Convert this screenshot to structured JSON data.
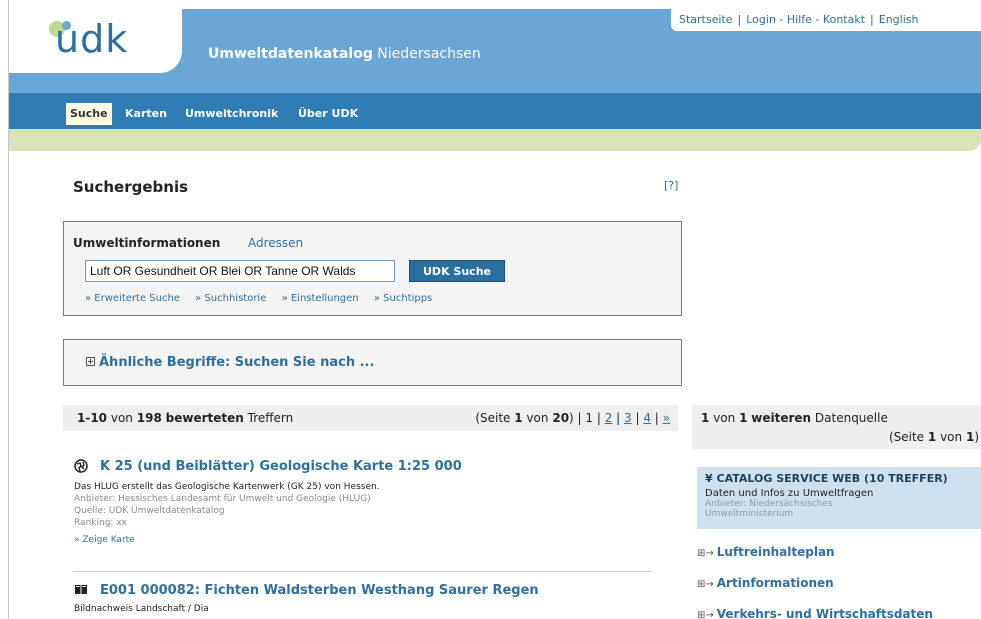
{
  "header": {
    "logo_text": "udk",
    "site_title_bold": "Umweltdatenkatalog",
    "site_title_rest": "Niedersachsen",
    "toplinks": {
      "start": "Startseite",
      "sep": "|",
      "login": "Login",
      "dash": "-",
      "help": "Hilfe",
      "contact": "Kontakt",
      "english": "English"
    }
  },
  "nav": {
    "items": [
      "Suche",
      "Karten",
      "Umweltchronik",
      "Über UDK"
    ],
    "active": "Suche"
  },
  "page": {
    "title": "Suchergebnis",
    "help": "[?]"
  },
  "search": {
    "tab_active": "Umweltinformationen",
    "tab_other": "Adressen",
    "query": "Luft OR Gesundheit OR Blei OR Tanne OR Walds",
    "button": "UDK Suche",
    "links": [
      "Erweiterte Suche",
      "Suchhistorie",
      "Einstellungen",
      "Suchtipps"
    ]
  },
  "similar": {
    "label": "Ähnliche Begriffe: Suchen Sie nach ..."
  },
  "results": {
    "range": "1-10",
    "von": "von",
    "total": "198",
    "bewerteten": "bewerteten",
    "treffern": "Treffern",
    "seite_label": "(Seite",
    "seite_num": "1",
    "seite_von": "von",
    "seite_total": "20",
    "seite_close": ")",
    "pages": [
      "1",
      "2",
      "3",
      "4",
      "»"
    ],
    "items": [
      {
        "title": "K 25 (und Beiblätter) Geologische Karte 1:25 000",
        "icon": "globe-icon",
        "desc": "Das HLUG erstellt das Geologische Kartenwerk (GK 25) von Hessen.",
        "anbieter": "Anbieter: Hessisches Landesamt für Umwelt und Geologie (HLUG)",
        "quelle": "Quelle: UDK Umweltdatenkatalog",
        "ranking": "Ranking: xx",
        "action": "Zeige Karte"
      },
      {
        "title": "E001 000082: Fichten Waldsterben Westhang Saurer Regen",
        "icon": "book-icon",
        "desc": "Bildnachweis Landschaft / Dia"
      }
    ]
  },
  "right": {
    "head_num": "1",
    "head_von": "von",
    "head_count": "1",
    "head_weiteren": "weiteren",
    "head_source": "Datenquelle",
    "page_text_pre": "(Seite",
    "page_num": "1",
    "page_von": "von",
    "page_total": "1",
    "page_close": ")",
    "catalog_title": "CATALOG SERVICE WEB (10 TREFFER)",
    "catalog_desc": "Daten und Infos zu Umweltfragen",
    "catalog_anbieter": "Anbieter: Niedersächsisches",
    "catalog_anbieter2": "Umweltministerium",
    "topics": [
      "Luftreinhalteplan",
      "Artinformationen",
      "Verkehrs- und Wirtschaftsdaten"
    ]
  },
  "colors": {
    "header_blue": "#6aa6d6",
    "nav_blue": "#2f7db4",
    "link_blue": "#2f6f9f",
    "green_band": "#d8e4b8",
    "catalog_bg": "#cfe1ee"
  }
}
